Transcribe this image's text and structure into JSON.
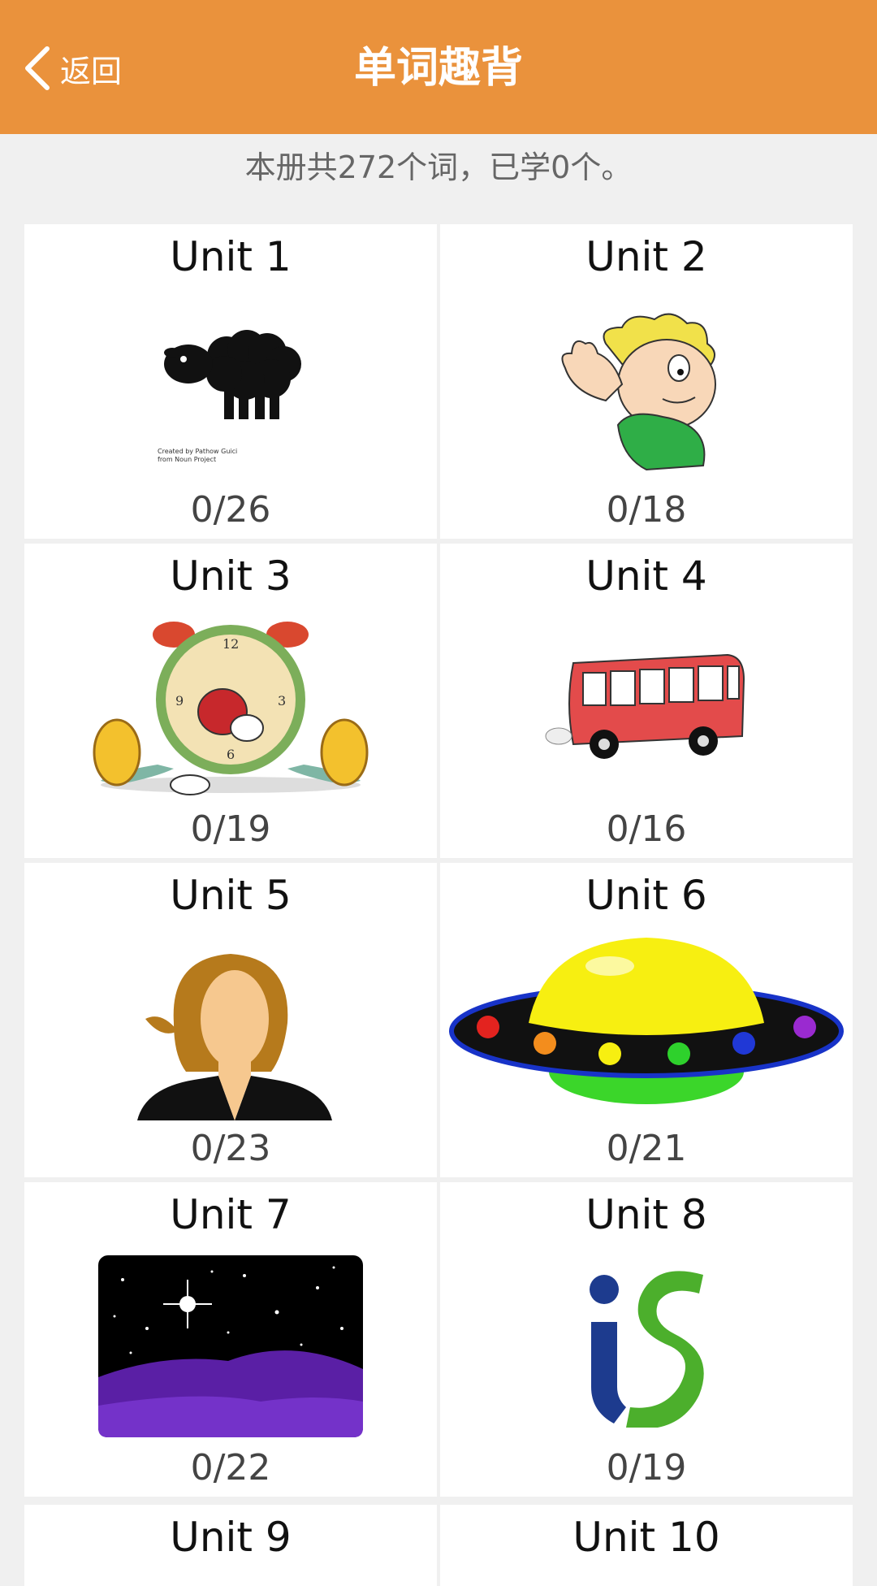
{
  "header": {
    "back_label": "返回",
    "title": "单词趣背",
    "bg_color": "#ea923c"
  },
  "summary": "本册共272个词，已学0个。",
  "units": [
    {
      "name": "Unit 1",
      "progress": "0/26",
      "icon": "sheep-icon",
      "credit": "Created by Pathow Guici from Noun Project"
    },
    {
      "name": "Unit 2",
      "progress": "0/18",
      "icon": "boy-listening-icon"
    },
    {
      "name": "Unit 3",
      "progress": "0/19",
      "icon": "yawning-clock-icon"
    },
    {
      "name": "Unit 4",
      "progress": "0/16",
      "icon": "bus-icon"
    },
    {
      "name": "Unit 5",
      "progress": "0/23",
      "icon": "woman-icon"
    },
    {
      "name": "Unit 6",
      "progress": "0/21",
      "icon": "ufo-icon"
    },
    {
      "name": "Unit 7",
      "progress": "0/22",
      "icon": "night-sky-icon"
    },
    {
      "name": "Unit 8",
      "progress": "0/19",
      "icon": "is-logo-icon"
    },
    {
      "name": "Unit 9"
    },
    {
      "name": "Unit 10"
    }
  ]
}
